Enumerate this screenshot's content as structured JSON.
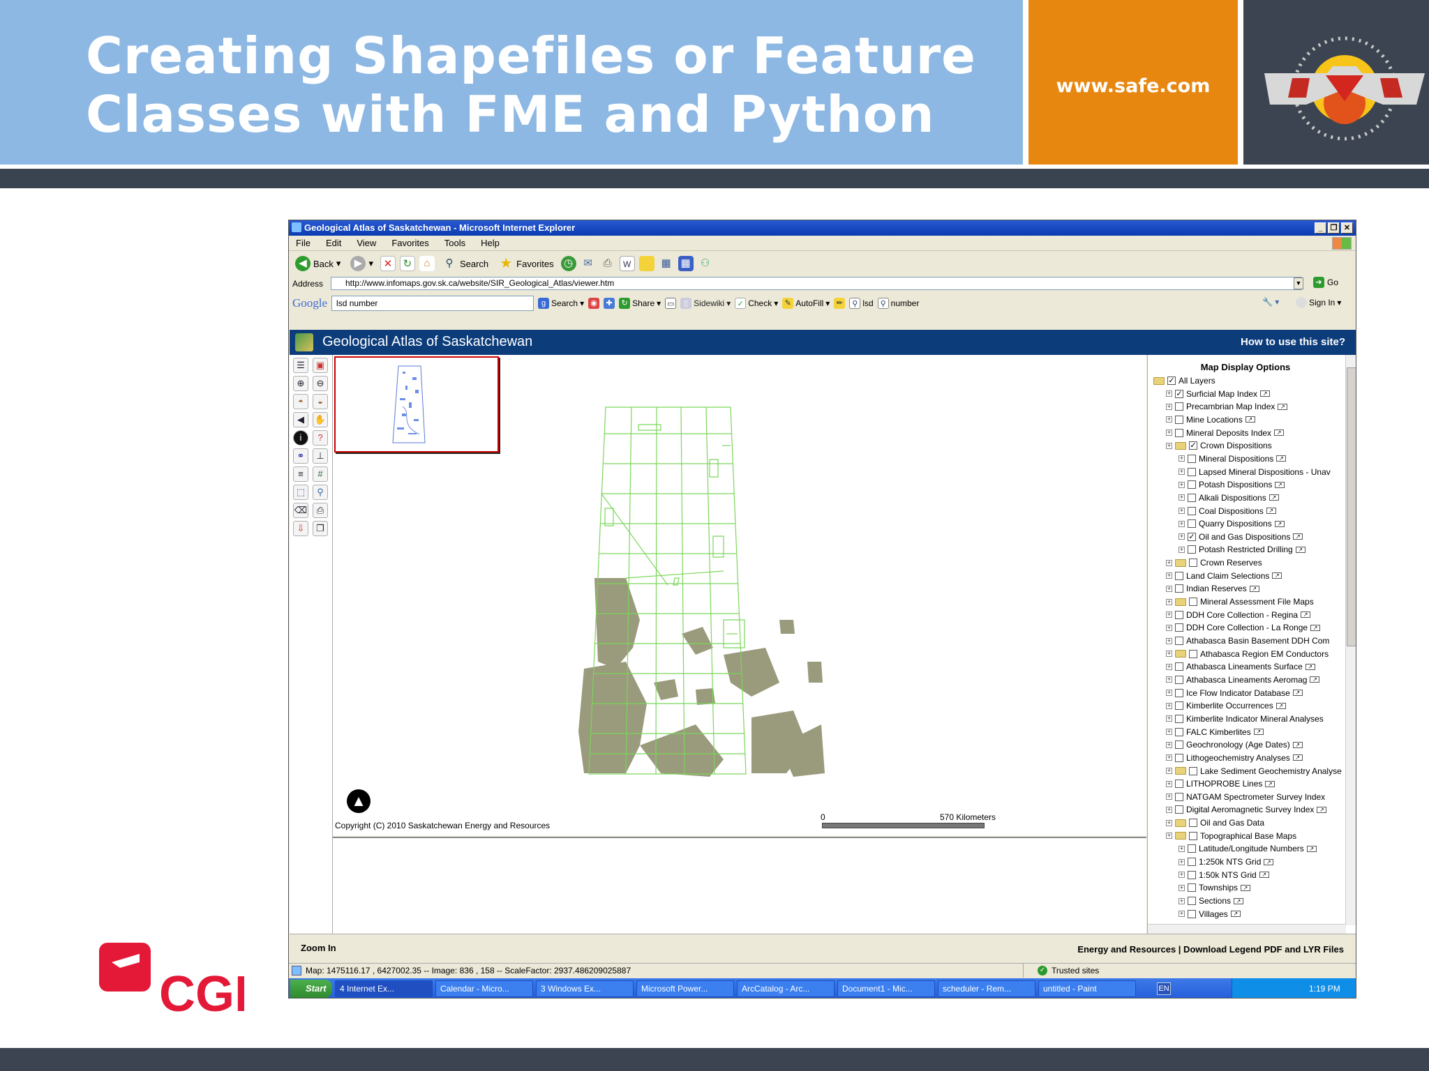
{
  "slide": {
    "title_line1": "Creating Shapefiles or Feature",
    "title_line2": "Classes with FME and Python",
    "url": "www.safe.com",
    "fme_logo_text": "FME",
    "cgi_logo_text": "CGI"
  },
  "window": {
    "title": "Geological Atlas of Saskatchewan - Microsoft Internet Explorer",
    "menu": [
      "File",
      "Edit",
      "View",
      "Favorites",
      "Tools",
      "Help"
    ],
    "toolbar": {
      "back": "Back",
      "search": "Search",
      "favorites": "Favorites"
    },
    "address_label": "Address",
    "address_url": "http://www.infomaps.gov.sk.ca/website/SIR_Geological_Atlas/viewer.htm",
    "go_label": "Go",
    "google": {
      "logo": "Google",
      "query": "lsd number",
      "search": "Search",
      "share": "Share",
      "sidewiki": "Sidewiki",
      "check": "Check",
      "autofill": "AutoFill",
      "lsd": "lsd",
      "number": "number",
      "sign_in": "Sign In"
    }
  },
  "app": {
    "title": "Geological Atlas of Saskatchewan",
    "how_to": "How to use this site?",
    "copyright": "Copyright (C) 2010 Saskatchewan Energy and Resources",
    "scale_zero": "0",
    "scale_max": "570 Kilometers",
    "zoom_in": "Zoom In",
    "footer_links": "Energy and Resources | Download Legend PDF and LYR Files"
  },
  "layers": {
    "title": "Map Display Options",
    "items": [
      {
        "label": "All Layers",
        "indent": 0,
        "folder": true,
        "checked": true,
        "plus": false
      },
      {
        "label": "Surficial Map Index",
        "indent": 1,
        "checked": true,
        "legend": true
      },
      {
        "label": "Precambrian Map Index",
        "indent": 1,
        "checked": false,
        "legend": true
      },
      {
        "label": "Mine Locations",
        "indent": 1,
        "checked": false,
        "legend": true
      },
      {
        "label": "Mineral Deposits Index",
        "indent": 1,
        "checked": false,
        "legend": true
      },
      {
        "label": "Crown Dispositions",
        "indent": 1,
        "folder": true,
        "checked": true
      },
      {
        "label": "Mineral Dispositions",
        "indent": 2,
        "checked": false,
        "legend": true
      },
      {
        "label": "Lapsed Mineral Dispositions - Unav",
        "indent": 2,
        "checked": false
      },
      {
        "label": "Potash Dispositions",
        "indent": 2,
        "checked": false,
        "legend": true
      },
      {
        "label": "Alkali Dispositions",
        "indent": 2,
        "checked": false,
        "legend": true
      },
      {
        "label": "Coal Dispositions",
        "indent": 2,
        "checked": false,
        "legend": true
      },
      {
        "label": "Quarry Dispositions",
        "indent": 2,
        "checked": false,
        "legend": true
      },
      {
        "label": "Oil and Gas Dispositions",
        "indent": 2,
        "checked": true,
        "legend": true
      },
      {
        "label": "Potash Restricted Drilling",
        "indent": 2,
        "checked": false,
        "legend": true
      },
      {
        "label": "Crown Reserves",
        "indent": 1,
        "folder": true,
        "checked": false
      },
      {
        "label": "Land Claim Selections",
        "indent": 1,
        "checked": false,
        "legend": true
      },
      {
        "label": "Indian Reserves",
        "indent": 1,
        "checked": false,
        "legend": true
      },
      {
        "label": "Mineral Assessment File Maps",
        "indent": 1,
        "folder": true,
        "checked": false
      },
      {
        "label": "DDH Core Collection - Regina",
        "indent": 1,
        "checked": false,
        "legend": true
      },
      {
        "label": "DDH Core Collection - La Ronge",
        "indent": 1,
        "checked": false,
        "legend": true
      },
      {
        "label": "Athabasca Basin Basement DDH Com",
        "indent": 1,
        "checked": false
      },
      {
        "label": "Athabasca Region EM Conductors",
        "indent": 1,
        "folder": true,
        "checked": false
      },
      {
        "label": "Athabasca Lineaments Surface",
        "indent": 1,
        "checked": false,
        "legend": true
      },
      {
        "label": "Athabasca Lineaments Aeromag",
        "indent": 1,
        "checked": false,
        "legend": true
      },
      {
        "label": "Ice Flow Indicator Database",
        "indent": 1,
        "checked": false,
        "legend": true
      },
      {
        "label": "Kimberlite Occurrences",
        "indent": 1,
        "checked": false,
        "legend": true
      },
      {
        "label": "Kimberlite Indicator Mineral Analyses",
        "indent": 1,
        "checked": false
      },
      {
        "label": "FALC Kimberlites",
        "indent": 1,
        "checked": false,
        "legend": true
      },
      {
        "label": "Geochronology (Age Dates)",
        "indent": 1,
        "checked": false,
        "legend": true
      },
      {
        "label": "Lithogeochemistry Analyses",
        "indent": 1,
        "checked": false,
        "legend": true
      },
      {
        "label": "Lake Sediment Geochemistry Analyse",
        "indent": 1,
        "folder": true,
        "checked": false
      },
      {
        "label": "LITHOPROBE Lines",
        "indent": 1,
        "checked": false,
        "legend": true
      },
      {
        "label": "NATGAM Spectrometer Survey Index",
        "indent": 1,
        "checked": false
      },
      {
        "label": "Digital Aeromagnetic Survey Index",
        "indent": 1,
        "checked": false,
        "legend": true
      },
      {
        "label": "Oil and Gas Data",
        "indent": 1,
        "folder": true,
        "checked": false
      },
      {
        "label": "Topographical Base Maps",
        "indent": 1,
        "folder": true,
        "checked": false
      },
      {
        "label": "Latitude/Longitude Numbers",
        "indent": 2,
        "checked": false,
        "legend": true
      },
      {
        "label": "1:250k NTS Grid",
        "indent": 2,
        "checked": false,
        "legend": true
      },
      {
        "label": "1:50k NTS Grid",
        "indent": 2,
        "checked": false,
        "legend": true
      },
      {
        "label": "Townships",
        "indent": 2,
        "checked": false,
        "legend": true
      },
      {
        "label": "Sections",
        "indent": 2,
        "checked": false,
        "legend": true
      },
      {
        "label": "Villages",
        "indent": 2,
        "checked": false,
        "legend": true
      }
    ]
  },
  "status": {
    "text": "Map: 1475116.17 , 6427002.35 -- Image: 836 , 158 -- ScaleFactor: 2937.486209025887",
    "zone": "Trusted sites"
  },
  "taskbar": {
    "start": "Start",
    "tasks": [
      "4 Internet Ex...",
      "Calendar - Micro...",
      "3 Windows Ex...",
      "Microsoft Power...",
      "ArcCatalog - Arc...",
      "Document1 - Mic...",
      "scheduler - Rem...",
      "untitled - Paint"
    ],
    "lang": "EN",
    "time": "1:19 PM"
  }
}
